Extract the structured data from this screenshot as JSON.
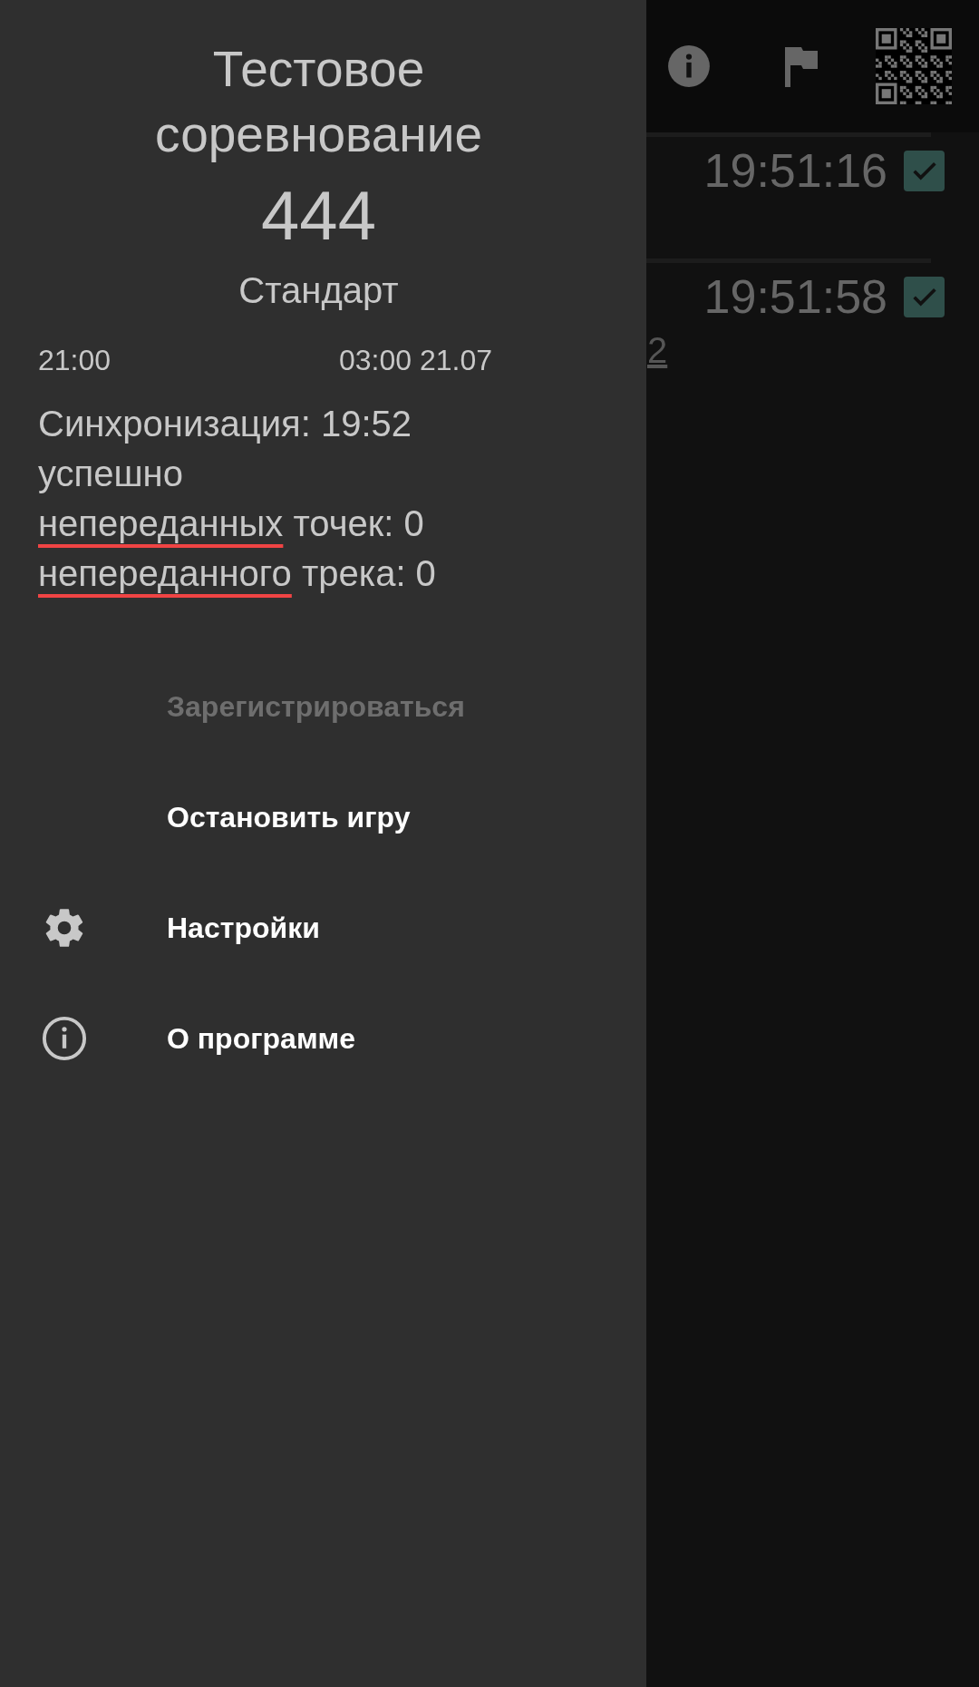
{
  "toolbar": {
    "actions": [
      {
        "kind": "info"
      },
      {
        "kind": "flag"
      },
      {
        "kind": "qr"
      }
    ]
  },
  "rows": [
    {
      "time": "19:51:16",
      "checked": true
    },
    {
      "time": "19:51:58",
      "checked": true,
      "note": "2"
    }
  ],
  "drawer": {
    "title": "Тестовое соревнование",
    "number": "444",
    "mode": "Стандарт",
    "start_time": "21:00",
    "end_time": "03:00 21.07",
    "sync_lines": [
      {
        "text": "Синхронизация: 19:52"
      },
      {
        "text": "успешно"
      },
      {
        "spellcheck_flagged": "непереданных",
        "text": "точек: 0"
      },
      {
        "spellcheck_flagged": "непереданного",
        "text": "трека: 0"
      }
    ],
    "menu": [
      {
        "label": "Зарегистрироваться",
        "kind": "plain",
        "disabled": true
      },
      {
        "label": "Остановить игру",
        "kind": "plain",
        "disabled": false
      },
      {
        "label": "Настройки",
        "kind": "settings",
        "disabled": false
      },
      {
        "label": "О программе",
        "kind": "about",
        "disabled": false
      }
    ]
  }
}
